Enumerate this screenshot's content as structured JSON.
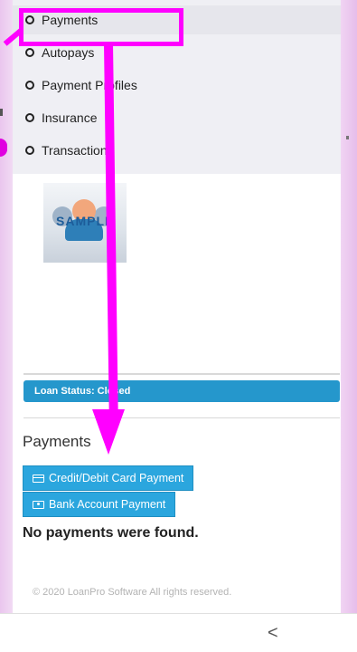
{
  "menu": {
    "items": [
      {
        "label": "Payments",
        "active": true
      },
      {
        "label": "Autopays"
      },
      {
        "label": "Payment Profiles"
      },
      {
        "label": "Insurance"
      },
      {
        "label": "Transactions"
      }
    ]
  },
  "sample_image": {
    "watermark": "SAMPLE"
  },
  "loan_status": "Loan Status: Closed",
  "payments_section": {
    "title": "Payments",
    "card_button": "Credit/Debit Card Payment",
    "bank_button": "Bank Account Payment",
    "empty_message": "No payments were found."
  },
  "footer": "© 2020 LoanPro Software All rights reserved.",
  "nav": {
    "back_icon": "chevron-left-icon",
    "back_glyph": "<"
  },
  "colors": {
    "accent": "#2ba6de",
    "status_bar": "#2597cc",
    "annotation": "#ff00ff"
  }
}
